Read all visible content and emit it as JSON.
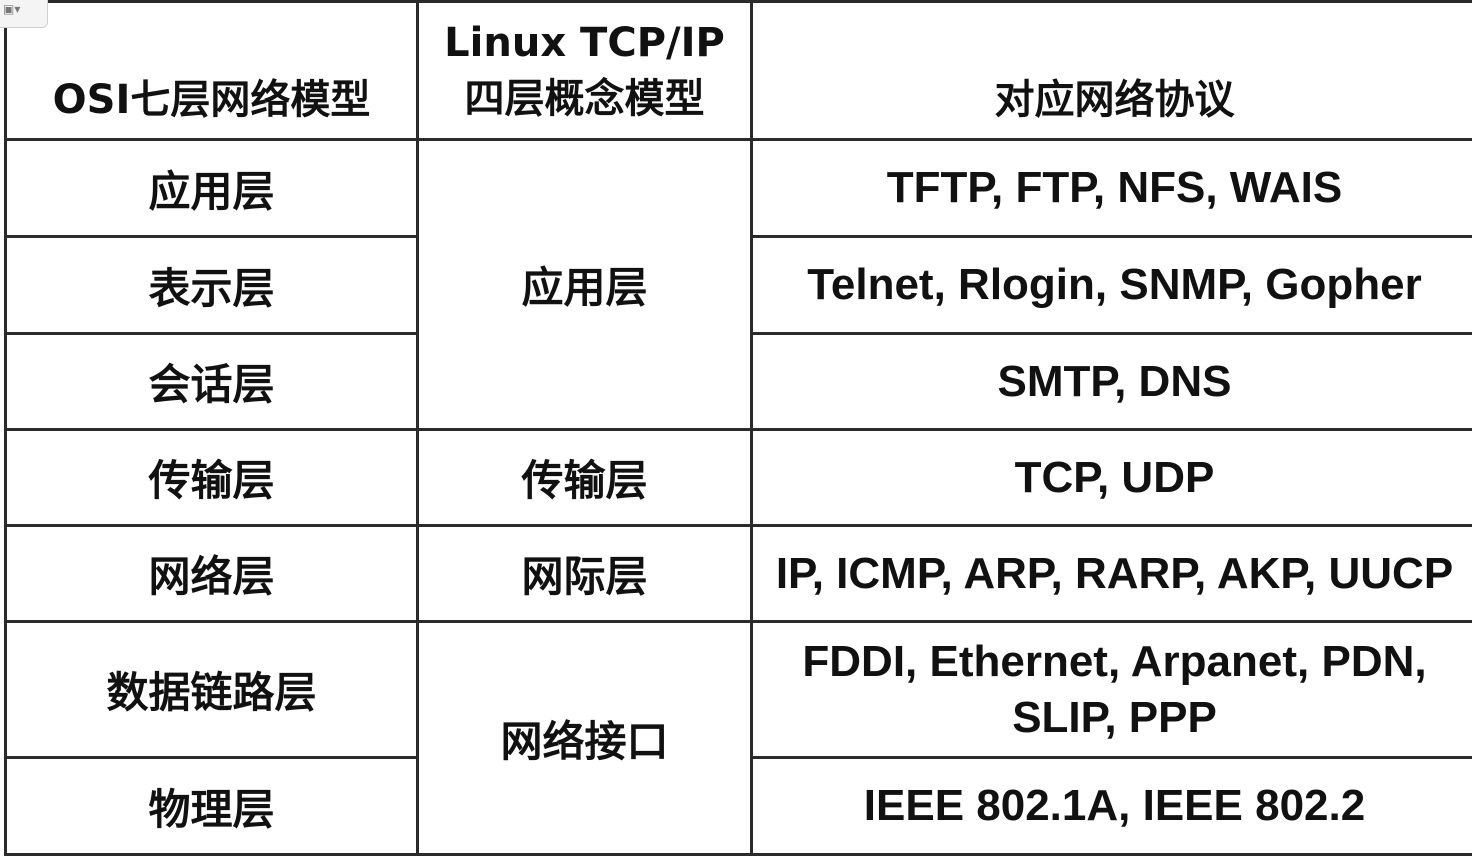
{
  "header": {
    "osi_model": "OSI七层网络模型",
    "tcpip_line1": "Linux TCP/IP",
    "tcpip_line2": "四层概念模型",
    "protocols": "对应网络协议"
  },
  "tcpip_layers": {
    "application": "应用层",
    "transport": "传输层",
    "internet": "网际层",
    "network_interface": "网络接口"
  },
  "rows": [
    {
      "osi": "应用层",
      "protocols": "TFTP, FTP, NFS, WAIS"
    },
    {
      "osi": "表示层",
      "protocols": "Telnet, Rlogin, SNMP, Gopher"
    },
    {
      "osi": "会话层",
      "protocols": "SMTP, DNS"
    },
    {
      "osi": "传输层",
      "protocols": "TCP, UDP"
    },
    {
      "osi": "网络层",
      "protocols": "IP, ICMP, ARP, RARP, AKP, UUCP"
    },
    {
      "osi": "数据链路层",
      "protocols_line1": "FDDI, Ethernet, Arpanet, PDN,",
      "protocols_line2": "SLIP, PPP"
    },
    {
      "osi": "物理层",
      "protocols": "IEEE 802.1A, IEEE 802.2"
    }
  ],
  "corner_icon": {
    "icon": "image-menu-icon",
    "glyph": "▣▾"
  }
}
